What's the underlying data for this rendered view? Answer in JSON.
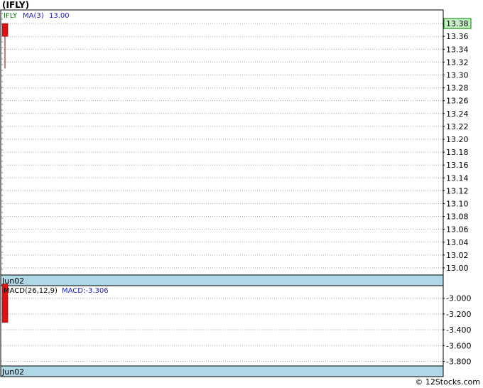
{
  "title": "(IFLY)",
  "footer": "© 12Stocks.com",
  "colors": {
    "up": "#e01010",
    "grid": "#aaaaaa",
    "date_bar": "#aed8e6",
    "last_price_bg": "#c6efc6",
    "ma_label": "#2020c0",
    "symbol_label": "#008000"
  },
  "chart_data": [
    {
      "type": "candlestick",
      "name": "price-panel",
      "symbol_label": "IFLY",
      "ma_label": "MA(3)",
      "ma_value": "13.00",
      "last_price": "13.38",
      "date_label": "Jun02",
      "ylim": [
        12.99,
        13.4
      ],
      "yticks": [
        "13.38",
        "13.36",
        "13.34",
        "13.32",
        "13.30",
        "13.28",
        "13.26",
        "13.24",
        "13.22",
        "13.20",
        "13.18",
        "13.16",
        "13.14",
        "13.12",
        "13.10",
        "13.08",
        "13.06",
        "13.04",
        "13.02",
        "13.00"
      ],
      "candles": [
        {
          "date": "Jun02",
          "open": 13.36,
          "close": 13.38,
          "high": 13.38,
          "low": 13.31
        }
      ],
      "grid": true
    },
    {
      "type": "bar",
      "name": "macd-panel",
      "label": "MACD(26,12,9)",
      "value_label": "MACD:-3.306",
      "date_label": "Jun02",
      "ylim": [
        -3.85,
        -2.85
      ],
      "yticks": [
        "-3.000",
        "-3.200",
        "-3.400",
        "-3.600",
        "-3.800"
      ],
      "bars": [
        {
          "date": "Jun02",
          "top": -2.82,
          "bottom": -3.306
        }
      ],
      "grid": true
    }
  ]
}
